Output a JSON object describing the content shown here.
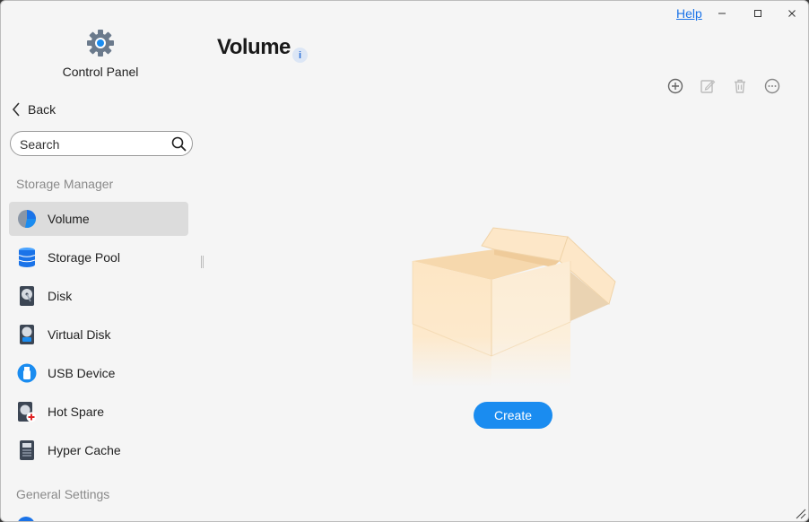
{
  "titlebar": {
    "help_label": "Help"
  },
  "sidebar": {
    "app_title": "Control Panel",
    "back_label": "Back",
    "search_placeholder": "Search",
    "section_storage": "Storage Manager",
    "section_general": "General Settings",
    "items": [
      {
        "label": "Volume",
        "icon": "volume-pie-icon",
        "active": true
      },
      {
        "label": "Storage Pool",
        "icon": "storage-pool-icon"
      },
      {
        "label": "Disk",
        "icon": "disk-icon"
      },
      {
        "label": "Virtual Disk",
        "icon": "virtual-disk-icon"
      },
      {
        "label": "USB Device",
        "icon": "usb-icon"
      },
      {
        "label": "Hot Spare",
        "icon": "hot-spare-icon"
      },
      {
        "label": "Hyper Cache",
        "icon": "hyper-cache-icon"
      }
    ]
  },
  "main": {
    "title": "Volume",
    "toolbar": [
      "add-icon",
      "edit-icon",
      "delete-icon",
      "more-icon"
    ],
    "empty_state": {
      "button_label": "Create"
    }
  },
  "colors": {
    "accent": "#1a8cf0",
    "link": "#1a73e8",
    "active_bg": "#dcdcdc"
  }
}
